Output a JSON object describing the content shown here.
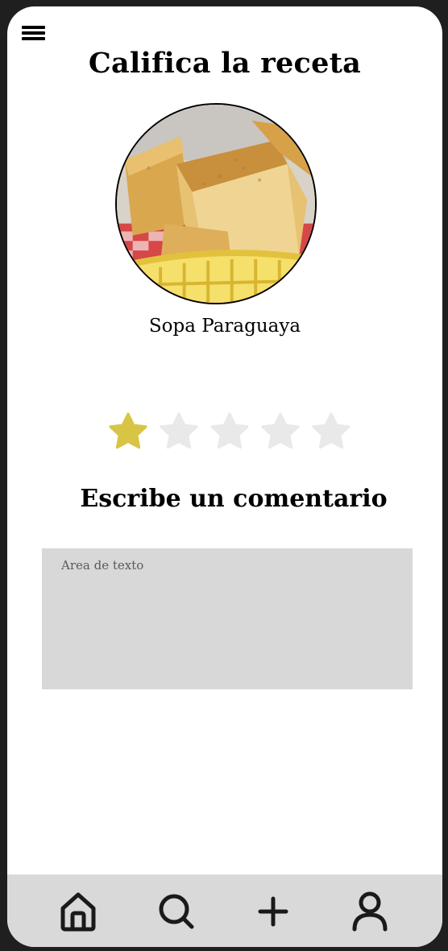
{
  "header": {
    "title": "Califica la receta",
    "menu_icon": "hamburger-menu-icon"
  },
  "recipe": {
    "name": "Sopa Paraguaya",
    "image": "sopa-paraguaya-photo"
  },
  "rating": {
    "value": 1,
    "max": 5,
    "filled_color": "#d9c545",
    "empty_color": "#e9e9e9"
  },
  "comment": {
    "heading": "Escribe un comentario",
    "placeholder": "Area de texto",
    "value": ""
  },
  "bottom_nav": {
    "items": [
      {
        "icon": "home-icon"
      },
      {
        "icon": "search-icon"
      },
      {
        "icon": "plus-icon"
      },
      {
        "icon": "user-icon"
      }
    ]
  },
  "colors": {
    "background": "#ffffff",
    "frame": "#1f1f1f",
    "nav_background": "#d9d9d9",
    "textarea_background": "#d8d8d8"
  }
}
